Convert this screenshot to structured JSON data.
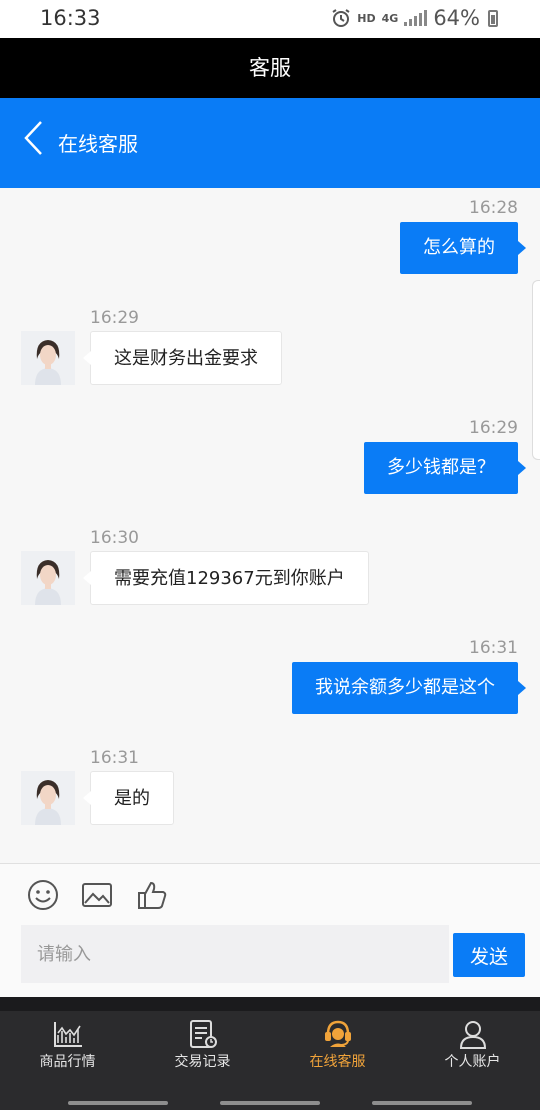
{
  "status_bar": {
    "time": "16:33",
    "hd": "HD",
    "network": "4G",
    "battery": "64%"
  },
  "title_bar": {
    "title": "客服"
  },
  "header": {
    "title": "在线客服"
  },
  "messages": [
    {
      "direction": "out",
      "time": "16:28",
      "text": "怎么算的"
    },
    {
      "direction": "in",
      "time": "16:29",
      "text": "这是财务出金要求"
    },
    {
      "direction": "out",
      "time": "16:29",
      "text": "多少钱都是？"
    },
    {
      "direction": "in",
      "time": "16:30",
      "text": "需要充值129367元到你账户"
    },
    {
      "direction": "out",
      "time": "16:31",
      "text": "我说余额多少都是这个"
    },
    {
      "direction": "in",
      "time": "16:31",
      "text": "是的"
    }
  ],
  "composer": {
    "placeholder": "请输入",
    "send_label": "发送",
    "tools": [
      "smiley-icon",
      "image-icon",
      "thumbs-up-icon"
    ]
  },
  "tabbar": {
    "tabs": [
      {
        "label": "商品行情",
        "icon": "chart-icon",
        "active": false
      },
      {
        "label": "交易记录",
        "icon": "record-icon",
        "active": false
      },
      {
        "label": "在线客服",
        "icon": "headset-icon",
        "active": true
      },
      {
        "label": "个人账户",
        "icon": "person-icon",
        "active": false
      }
    ]
  },
  "colors": {
    "accent": "#0a7cf6",
    "active_tab": "#f0a33a",
    "tabbar_bg": "#2b2b2d"
  }
}
